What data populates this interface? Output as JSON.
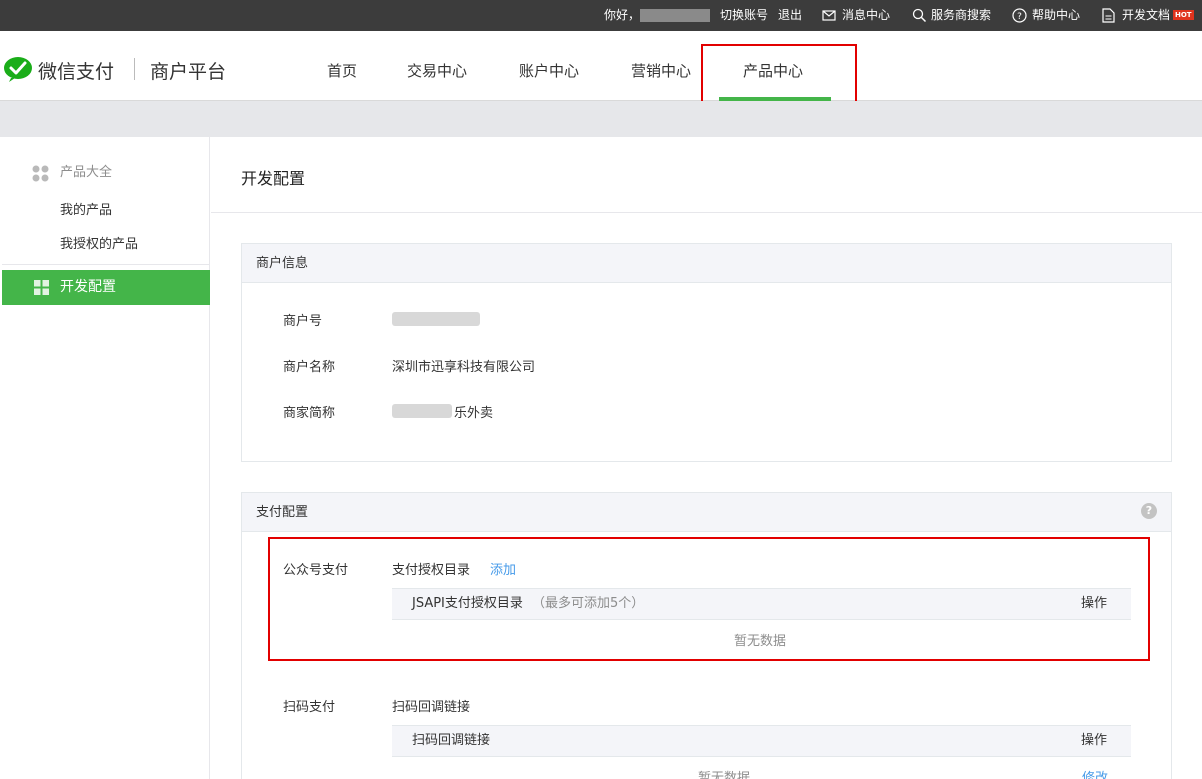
{
  "topbar": {
    "greeting": "你好，",
    "switch_account": "切换账号",
    "logout": "退出",
    "messages": "消息中心",
    "provider_search": "服务商搜索",
    "help": "帮助中心",
    "dev_docs": "开发文档",
    "hot_badge": "HOT"
  },
  "header": {
    "brand": "微信支付",
    "platform": "商户平台",
    "nav": [
      "首页",
      "交易中心",
      "账户中心",
      "营销中心",
      "产品中心"
    ],
    "active_nav": "产品中心"
  },
  "sidebar": {
    "group_label": "产品大全",
    "items": [
      "我的产品",
      "我授权的产品"
    ],
    "active_label": "开发配置"
  },
  "page": {
    "title": "开发配置"
  },
  "merchant_info": {
    "heading": "商户信息",
    "id_label": "商户号",
    "name_label": "商户名称",
    "name_value": "深圳市迅享科技有限公司",
    "short_label": "商家简称",
    "short_suffix": "乐外卖"
  },
  "pay_config": {
    "heading": "支付配置",
    "help": "?",
    "jsapi": {
      "label": "公众号支付",
      "dir_label": "支付授权目录",
      "add": "添加",
      "col_title": "JSAPI支付授权目录",
      "col_note": "（最多可添加5个）",
      "col_action": "操作",
      "empty": "暂无数据"
    },
    "native": {
      "label": "扫码支付",
      "cb_label": "扫码回调链接",
      "col_title": "扫码回调链接",
      "col_action": "操作",
      "empty": "暂无数据",
      "edit": "修改"
    }
  },
  "colors": {
    "accent": "#44b549",
    "highlight": "#e20000",
    "link": "#459ae9",
    "topbar": "#3c3c3c"
  }
}
